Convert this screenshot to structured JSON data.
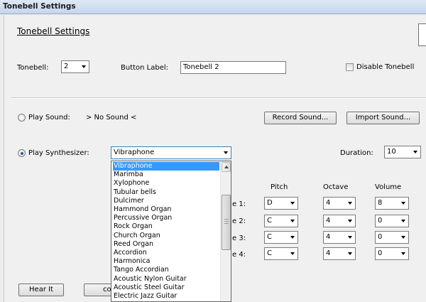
{
  "window": {
    "title": "Tonebell Settings"
  },
  "heading": "Tonebell Settings",
  "tonebell": {
    "label": "Tonebell:",
    "value": "2"
  },
  "button_label": {
    "label": "Button Label:",
    "value": "Tonebell 2"
  },
  "disable": {
    "label": "Disable Tonebell",
    "checked": false
  },
  "play_sound": {
    "label": "Play Sound:",
    "value": "> No Sound <",
    "record": "Record Sound...",
    "import": "Import Sound...",
    "selected": false
  },
  "play_synth": {
    "label": "Play Synthesizer:",
    "value": "Vibraphone",
    "selected": true
  },
  "duration": {
    "label": "Duration:",
    "value": "10"
  },
  "columns": {
    "pitch": "Pitch",
    "octave": "Octave",
    "volume": "Volume"
  },
  "notes": [
    {
      "label_tail": "e 1:",
      "pitch": "D",
      "octave": "4",
      "volume": "8"
    },
    {
      "label_tail": "e 2:",
      "pitch": "C",
      "octave": "4",
      "volume": "0"
    },
    {
      "label_tail": "e 3:",
      "pitch": "C",
      "octave": "4",
      "volume": "0"
    },
    {
      "label_tail": "e 4:",
      "pitch": "C",
      "octave": "4",
      "volume": "0"
    }
  ],
  "buttons": {
    "hear_it": "Hear It",
    "partial": "co"
  },
  "instruments": [
    "Vibraphone",
    "Marimba",
    "Xylophone",
    "Tubular bells",
    "Dulcimer",
    "Hammond Organ",
    "Percussive Organ",
    "Rock Organ",
    "Church Organ",
    "Reed Organ",
    "Accordion",
    "Harmonica",
    "Tango Accordian",
    "Acoustic Nylon Guitar",
    "Acoustic Steel Guitar",
    "Electric Jazz Guitar"
  ]
}
